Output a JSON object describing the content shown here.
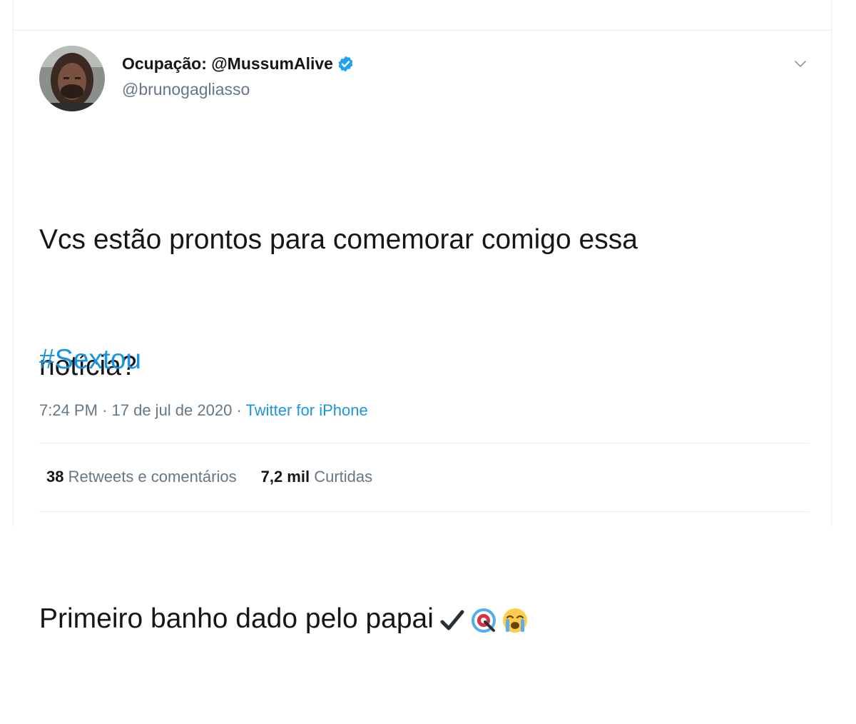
{
  "author": {
    "display_name": "Ocupação: @MussumAlive",
    "handle": "@brunogagliasso",
    "verified": true
  },
  "tweet": {
    "line1": "Vcs estão prontos para comemorar comigo essa",
    "line2": "notícia?",
    "line3": "Primeiro banho dado pelo papai",
    "emojis": [
      "check-mark-icon",
      "target-icon",
      "crying-face-icon"
    ],
    "hashtag": "#Sextou"
  },
  "meta": {
    "time": "7:24 PM",
    "separator": "·",
    "date": "17 de jul de 2020",
    "source": "Twitter for iPhone"
  },
  "stats": {
    "retweets_count": "38",
    "retweets_label": "Retweets e comentários",
    "likes_count": "7,2 mil",
    "likes_label": "Curtidas"
  },
  "colors": {
    "link": "#1b95e0",
    "muted": "#657786",
    "text": "#14171a",
    "border": "#e6ecf0",
    "verified": "#1da1f2"
  }
}
